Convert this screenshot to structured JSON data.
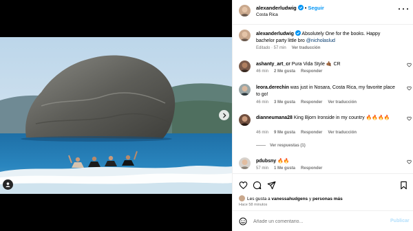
{
  "header": {
    "username": "alexanderludwig",
    "follow_label": "Seguir",
    "location": "Costa Rica"
  },
  "caption": {
    "username": "alexanderludwig",
    "text": " Absolutely One for the books. Happy bachelor party little bro ",
    "mention": "@nicholaslud",
    "meta_edited": "Editado · 57 min",
    "meta_translate": "Ver traducción"
  },
  "comments": [
    {
      "username": "ashanty_art_cr",
      "text": " Pura Vida Style",
      "emoji": "🤙🏾 CR",
      "time": "46 min",
      "likes": "2 Me gusta",
      "reply": "Responder",
      "translate": ""
    },
    {
      "username": "leora.derechin",
      "text": " was just in Nosara, Costa Rica, my favorite place to go!",
      "emoji": "",
      "time": "46 min",
      "likes": "3 Me gusta",
      "reply": "Responder",
      "translate": "Ver traducción"
    },
    {
      "username": "dianneumana28",
      "text": " King Bjorn Ironside in my country ",
      "emoji": "🔥🔥🔥🔥",
      "time": "46 min",
      "likes": "9 Me gusta",
      "reply": "Responder",
      "translate": "Ver traducción"
    },
    {
      "username": "pdubsny",
      "text": " ",
      "emoji": "🔥🔥",
      "time": "57 min",
      "likes": "1 Me gusta",
      "reply": "Responder",
      "translate": ""
    }
  ],
  "view_replies": "Ver respuestas (1)",
  "likes": {
    "prefix": "Les gusta a ",
    "user": "vanessahudgens",
    "middle": " y ",
    "others": "personas más"
  },
  "posted_time": "Hace 58 minutos",
  "add_comment": {
    "placeholder": "Añade un comentario...",
    "publish_label": "Publicar"
  },
  "icons": {
    "verified": "verified-badge-icon",
    "more": "more-options-icon",
    "heart": "heart-icon",
    "comment": "comment-icon",
    "share": "share-icon",
    "save": "bookmark-icon",
    "emoji": "emoji-icon",
    "next": "chevron-right-icon",
    "tag": "user-tag-icon"
  },
  "colors": {
    "accent": "#0095f6",
    "mention": "#00376b",
    "muted": "#737373"
  }
}
